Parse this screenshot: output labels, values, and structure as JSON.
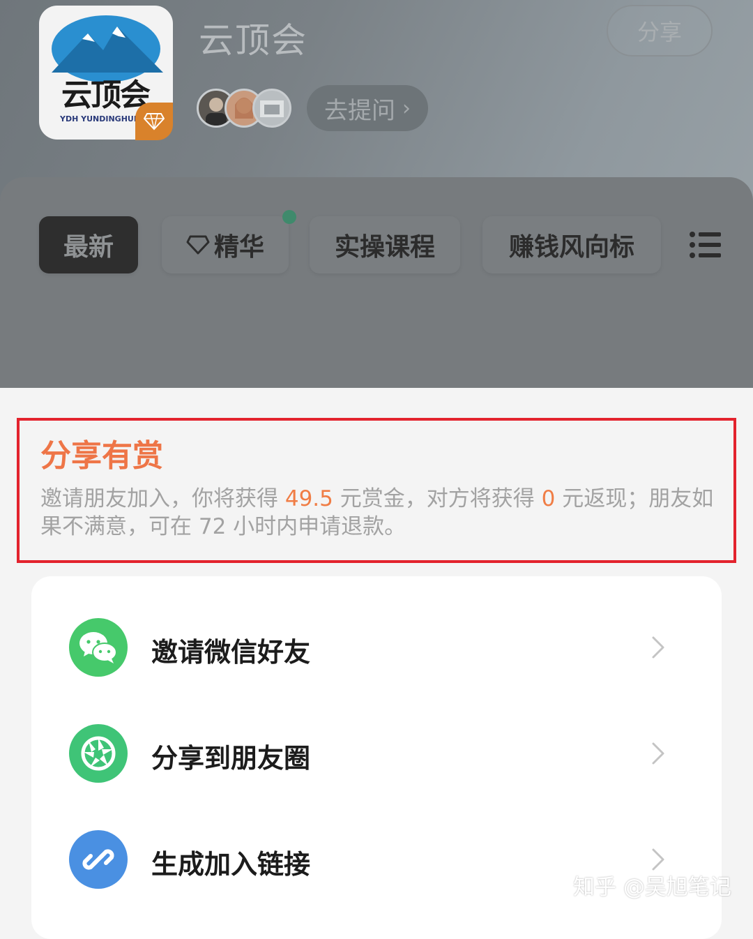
{
  "header": {
    "logo_text": "云顶会",
    "logo_subtext": "YDH YUNDINGHUI",
    "group_name": "云顶会",
    "share_label": "分享",
    "ask_label": "去提问",
    "ask_chevron": "›"
  },
  "tabs": [
    {
      "label": "最新",
      "active": true
    },
    {
      "label": "精华",
      "icon": "diamond-icon"
    },
    {
      "label": "实操课程"
    },
    {
      "label": "赚钱风向标"
    }
  ],
  "tabs_menu_icon": "list-menu-icon",
  "reward": {
    "title": "分享有赏",
    "desc_part1": "邀请朋友加入，你将获得 ",
    "earn_amount": "49.5",
    "desc_part2": " 元赏金，对方将获得 ",
    "friend_amount": "0",
    "desc_part3": " 元返现；朋友如果不满意，可在 72 小时内申请退款。"
  },
  "share_options": [
    {
      "label": "邀请微信好友",
      "icon": "wechat-icon",
      "color": "#46c96b"
    },
    {
      "label": "分享到朋友圈",
      "icon": "moments-icon",
      "color": "#3fc477"
    },
    {
      "label": "生成加入链接",
      "icon": "link-icon",
      "color": "#4a90e2"
    }
  ],
  "watermark": "知乎 @吴旭笔记",
  "colors": {
    "reward_title": "#ee7547",
    "highlight_amount": "#f07d45",
    "annotation_border": "#e3232d"
  }
}
